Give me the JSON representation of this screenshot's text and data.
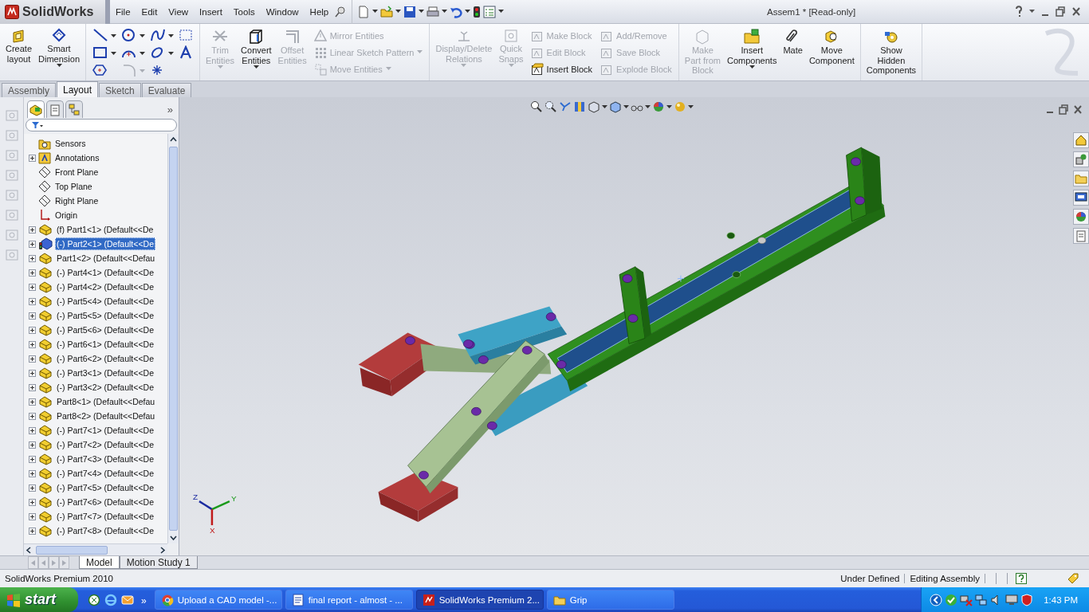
{
  "title_bar": {
    "logo": "SolidWorks",
    "menu": [
      "File",
      "Edit",
      "View",
      "Insert",
      "Tools",
      "Window",
      "Help"
    ],
    "document_title": "Assem1 * [Read-only]"
  },
  "ribbon": [
    {
      "items": [
        {
          "kind": "big",
          "label": "Create\nlayout",
          "disabled": false,
          "menu": false
        },
        {
          "kind": "big",
          "label": "Smart\nDimension",
          "disabled": false,
          "menu": true
        }
      ]
    },
    {
      "items": [
        {
          "kind": "sketch_tools"
        }
      ]
    },
    {
      "items": [
        {
          "kind": "big",
          "label": "Trim\nEntities",
          "disabled": true,
          "menu": true
        },
        {
          "kind": "big",
          "label": "Convert\nEntities",
          "disabled": false,
          "menu": true
        },
        {
          "kind": "big",
          "label": "Offset\nEntities",
          "disabled": true,
          "menu": false
        },
        {
          "kind": "stack",
          "items": [
            {
              "label": "Mirror Entities",
              "disabled": true,
              "menu": false
            },
            {
              "label": "Linear Sketch Pattern",
              "disabled": true,
              "menu": true
            },
            {
              "label": "Move Entities",
              "disabled": true,
              "menu": true
            }
          ]
        }
      ]
    },
    {
      "items": [
        {
          "kind": "big",
          "label": "Display/Delete\nRelations",
          "disabled": true,
          "menu": true
        },
        {
          "kind": "big",
          "label": "Quick\nSnaps",
          "disabled": true,
          "menu": true
        },
        {
          "kind": "stack",
          "items": [
            {
              "label": "Make Block",
              "disabled": true,
              "menu": false
            },
            {
              "label": "Edit Block",
              "disabled": true,
              "menu": false
            },
            {
              "label": "Insert Block",
              "disabled": false,
              "menu": false
            }
          ]
        },
        {
          "kind": "stack",
          "items": [
            {
              "label": "Add/Remove",
              "disabled": true,
              "menu": false
            },
            {
              "label": "Save Block",
              "disabled": true,
              "menu": false
            },
            {
              "label": "Explode Block",
              "disabled": true,
              "menu": false
            }
          ]
        }
      ]
    },
    {
      "items": [
        {
          "kind": "big",
          "label": "Make\nPart from\nBlock",
          "disabled": true,
          "menu": false
        },
        {
          "kind": "big",
          "label": "Insert\nComponents",
          "disabled": false,
          "menu": true
        },
        {
          "kind": "big",
          "label": "Mate",
          "disabled": false,
          "menu": false
        },
        {
          "kind": "big",
          "label": "Move\nComponent",
          "disabled": false,
          "menu": false
        }
      ]
    },
    {
      "items": [
        {
          "kind": "big",
          "label": "Show\nHidden\nComponents",
          "disabled": false,
          "menu": false
        }
      ]
    }
  ],
  "command_tabs": [
    {
      "label": "Assembly",
      "selected": false
    },
    {
      "label": "Layout",
      "selected": true
    },
    {
      "label": "Sketch",
      "selected": false
    },
    {
      "label": "Evaluate",
      "selected": false
    }
  ],
  "tree": {
    "more": "»",
    "items": [
      {
        "kind": "sensors",
        "label": "Sensors",
        "expandable": false,
        "selected": false
      },
      {
        "kind": "annotations",
        "label": "Annotations",
        "expandable": true,
        "selected": false
      },
      {
        "kind": "plane",
        "label": "Front Plane",
        "expandable": false,
        "selected": false
      },
      {
        "kind": "plane",
        "label": "Top Plane",
        "expandable": false,
        "selected": false
      },
      {
        "kind": "plane",
        "label": "Right Plane",
        "expandable": false,
        "selected": false
      },
      {
        "kind": "origin",
        "label": "Origin",
        "expandable": false,
        "selected": false
      },
      {
        "kind": "part",
        "label": "(f) Part1<1> (Default<<De",
        "expandable": true,
        "selected": false
      },
      {
        "kind": "flagged_part",
        "label": "(-) Part2<1> (Default<<De",
        "expandable": true,
        "selected": true
      },
      {
        "kind": "part",
        "label": "Part1<2> (Default<<Defau",
        "expandable": true,
        "selected": false
      },
      {
        "kind": "part",
        "label": "(-) Part4<1> (Default<<De",
        "expandable": true,
        "selected": false
      },
      {
        "kind": "part",
        "label": "(-) Part4<2> (Default<<De",
        "expandable": true,
        "selected": false
      },
      {
        "kind": "part",
        "label": "(-) Part5<4> (Default<<De",
        "expandable": true,
        "selected": false
      },
      {
        "kind": "part",
        "label": "(-) Part5<5> (Default<<De",
        "expandable": true,
        "selected": false
      },
      {
        "kind": "part",
        "label": "(-) Part5<6> (Default<<De",
        "expandable": true,
        "selected": false
      },
      {
        "kind": "part",
        "label": "(-) Part6<1> (Default<<De",
        "expandable": true,
        "selected": false
      },
      {
        "kind": "part",
        "label": "(-) Part6<2> (Default<<De",
        "expandable": true,
        "selected": false
      },
      {
        "kind": "part",
        "label": "(-) Part3<1> (Default<<De",
        "expandable": true,
        "selected": false
      },
      {
        "kind": "part",
        "label": "(-) Part3<2> (Default<<De",
        "expandable": true,
        "selected": false
      },
      {
        "kind": "part",
        "label": "Part8<1> (Default<<Defau",
        "expandable": true,
        "selected": false
      },
      {
        "kind": "part",
        "label": "Part8<2> (Default<<Defau",
        "expandable": true,
        "selected": false
      },
      {
        "kind": "part",
        "label": "(-) Part7<1> (Default<<De",
        "expandable": true,
        "selected": false
      },
      {
        "kind": "part",
        "label": "(-) Part7<2> (Default<<De",
        "expandable": true,
        "selected": false
      },
      {
        "kind": "part",
        "label": "(-) Part7<3> (Default<<De",
        "expandable": true,
        "selected": false
      },
      {
        "kind": "part",
        "label": "(-) Part7<4> (Default<<De",
        "expandable": true,
        "selected": false
      },
      {
        "kind": "part",
        "label": "(-) Part7<5> (Default<<De",
        "expandable": true,
        "selected": false
      },
      {
        "kind": "part",
        "label": "(-) Part7<6> (Default<<De",
        "expandable": true,
        "selected": false
      },
      {
        "kind": "part",
        "label": "(-) Part7<7> (Default<<De",
        "expandable": true,
        "selected": false
      },
      {
        "kind": "part",
        "label": "(-) Part7<8> (Default<<De",
        "expandable": true,
        "selected": false
      }
    ]
  },
  "viewport": {
    "triad": {
      "z": "Z",
      "y": "Y",
      "x": "X"
    }
  },
  "bottom_tabs": [
    {
      "label": "Model",
      "selected": true
    },
    {
      "label": "Motion Study 1",
      "selected": false
    }
  ],
  "status_bar": {
    "product": "SolidWorks Premium 2010",
    "state": "Under Defined",
    "mode": "Editing Assembly"
  },
  "taskbar": {
    "start": "start",
    "more": "»",
    "tasks": [
      {
        "label": "Upload a CAD model -...",
        "selected": false
      },
      {
        "label": "final report - almost - ...",
        "selected": false
      },
      {
        "label": "SolidWorks Premium 2...",
        "selected": true
      },
      {
        "label": "Grip",
        "selected": false
      }
    ],
    "clock": "1:43 PM"
  }
}
